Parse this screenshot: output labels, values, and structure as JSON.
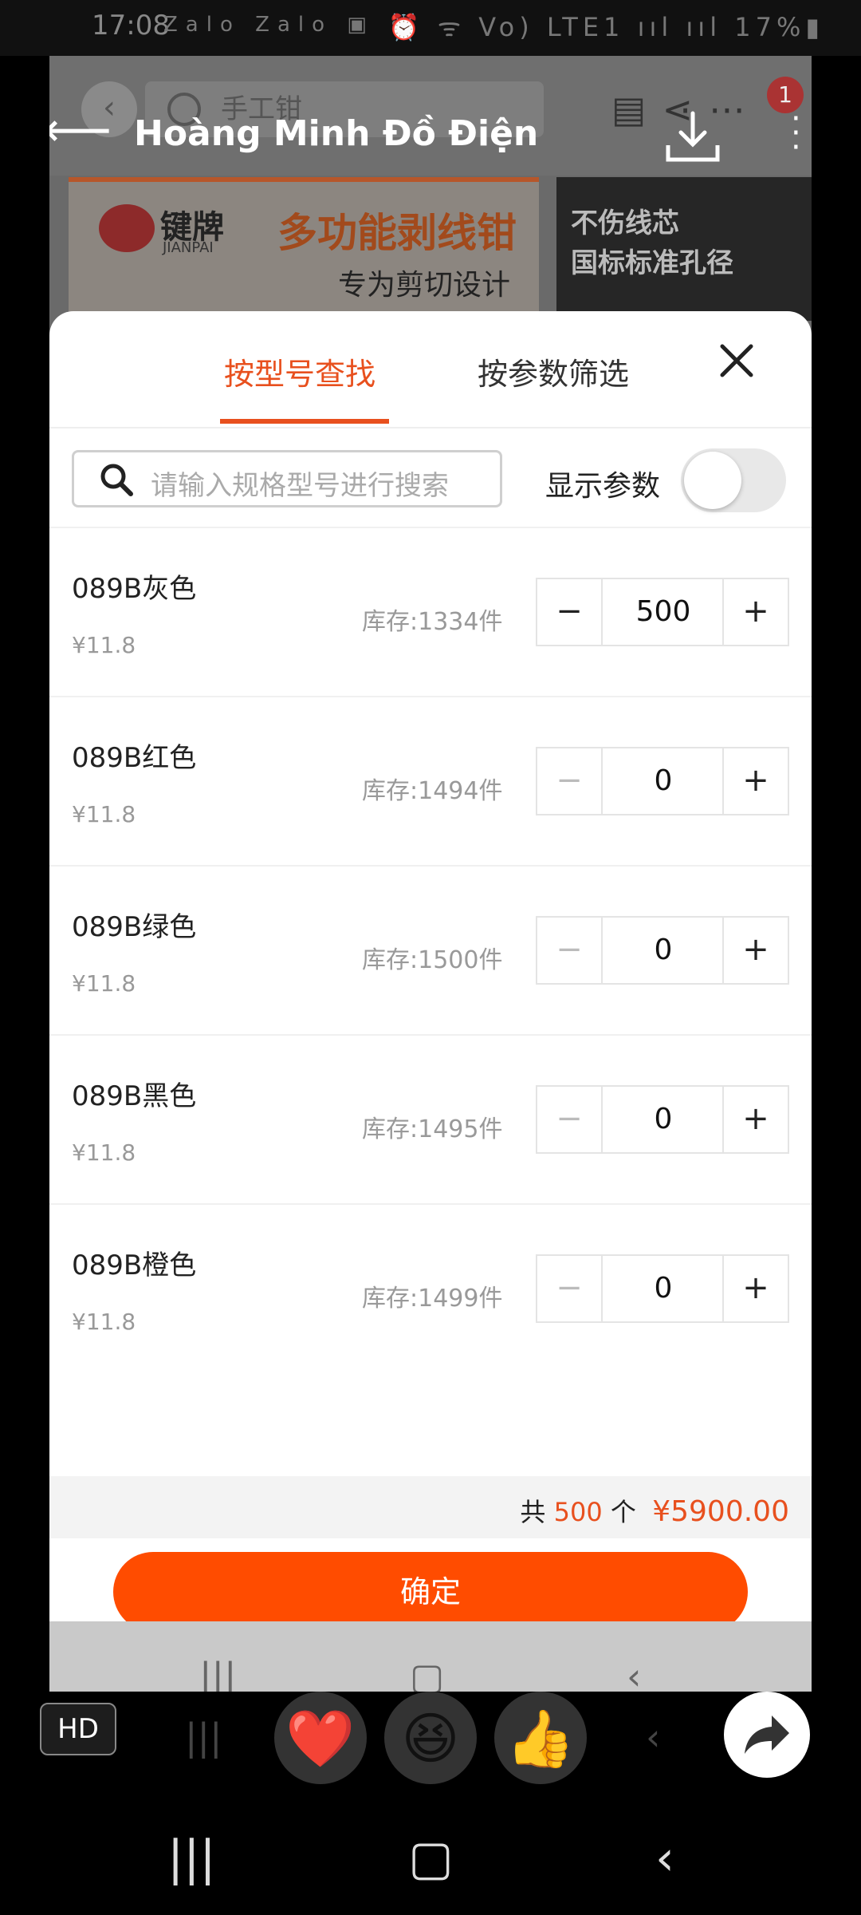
{
  "status_bar": {
    "time": "17:08",
    "left_icons": "Zalo Zalo ▣ •",
    "right_icons": "⏰ ᯤ Vo) LTE1 ııl ııl",
    "battery": "17%▮"
  },
  "app_header": {
    "search_placeholder": "手工钳",
    "cart_badge": "1",
    "overlay_title": "Hoàng Minh Đồ Điện"
  },
  "banner": {
    "brand_name": "键牌",
    "brand_sub": "JIANPAI",
    "headline": "多功能剥线钳",
    "subline": "专为剪切设计",
    "right_line1": "不伤线芯",
    "right_line2": "国标标准孔径"
  },
  "sheet": {
    "tab_active": "按型号查找",
    "tab_other": "按参数筛选",
    "search_placeholder": "请输入规格型号进行搜索",
    "show_params_label": "显示参数",
    "items": [
      {
        "name": "089B灰色",
        "price": "¥11.8",
        "stock": "库存:1334件",
        "qty": "500"
      },
      {
        "name": "089B红色",
        "price": "¥11.8",
        "stock": "库存:1494件",
        "qty": "0"
      },
      {
        "name": "089B绿色",
        "price": "¥11.8",
        "stock": "库存:1500件",
        "qty": "0"
      },
      {
        "name": "089B黑色",
        "price": "¥11.8",
        "stock": "库存:1495件",
        "qty": "0"
      },
      {
        "name": "089B橙色",
        "price": "¥11.8",
        "stock": "库存:1499件",
        "qty": "0"
      }
    ],
    "summary": {
      "prefix": "共",
      "count": "500",
      "unit": "个",
      "total": "¥5900.00"
    },
    "confirm_label": "确定"
  },
  "reaction_bar": {
    "hd_label": "HD",
    "reactions": [
      "❤️",
      "😆",
      "👍"
    ]
  },
  "colors": {
    "accent": "#e8501e",
    "confirm": "#ff4c00"
  }
}
